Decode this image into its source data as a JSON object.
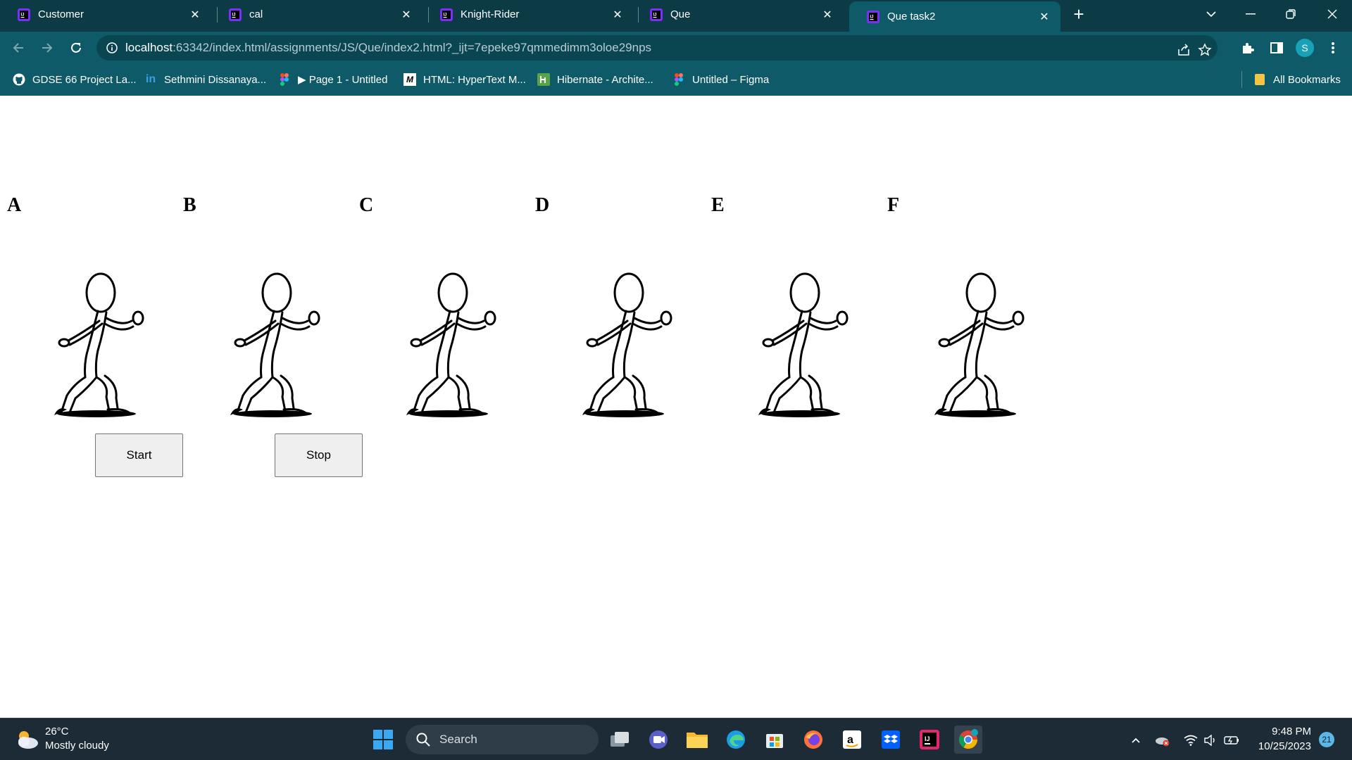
{
  "browser": {
    "tabs": [
      {
        "title": "Customer",
        "active": false
      },
      {
        "title": "cal",
        "active": false
      },
      {
        "title": "Knight-Rider",
        "active": false
      },
      {
        "title": "Que",
        "active": false
      },
      {
        "title": "Que task2",
        "active": true
      }
    ],
    "new_tab_symbol": "+",
    "url_host": "localhost",
    "url_path": ":63342/index.html/assignments/JS/Que/index2.html?_ijt=7epeke97qmmedimm3oloe29nps",
    "profile_initial": "S",
    "bookmarks": [
      {
        "label": "GDSE 66 Project La...",
        "icon": "github-icon"
      },
      {
        "label": "Sethmini Dissanaya...",
        "icon": "linkedin-icon"
      },
      {
        "label": "▶ Page 1 - Untitled",
        "icon": "figma-icon"
      },
      {
        "label": "HTML: HyperText M...",
        "icon": "mdn-icon"
      },
      {
        "label": "Hibernate - Archite...",
        "icon": "hibernate-icon"
      },
      {
        "label": "Untitled – Figma",
        "icon": "figma-icon"
      }
    ],
    "all_bookmarks": "All Bookmarks"
  },
  "page": {
    "letters": [
      "A",
      "B",
      "C",
      "D",
      "E",
      "F"
    ],
    "start_button": "Start",
    "stop_button": "Stop"
  },
  "taskbar": {
    "temperature": "26°C",
    "weather": "Mostly cloudy",
    "search_placeholder": "Search",
    "time": "9:48 PM",
    "date": "10/25/2023",
    "notification_count": "21"
  }
}
